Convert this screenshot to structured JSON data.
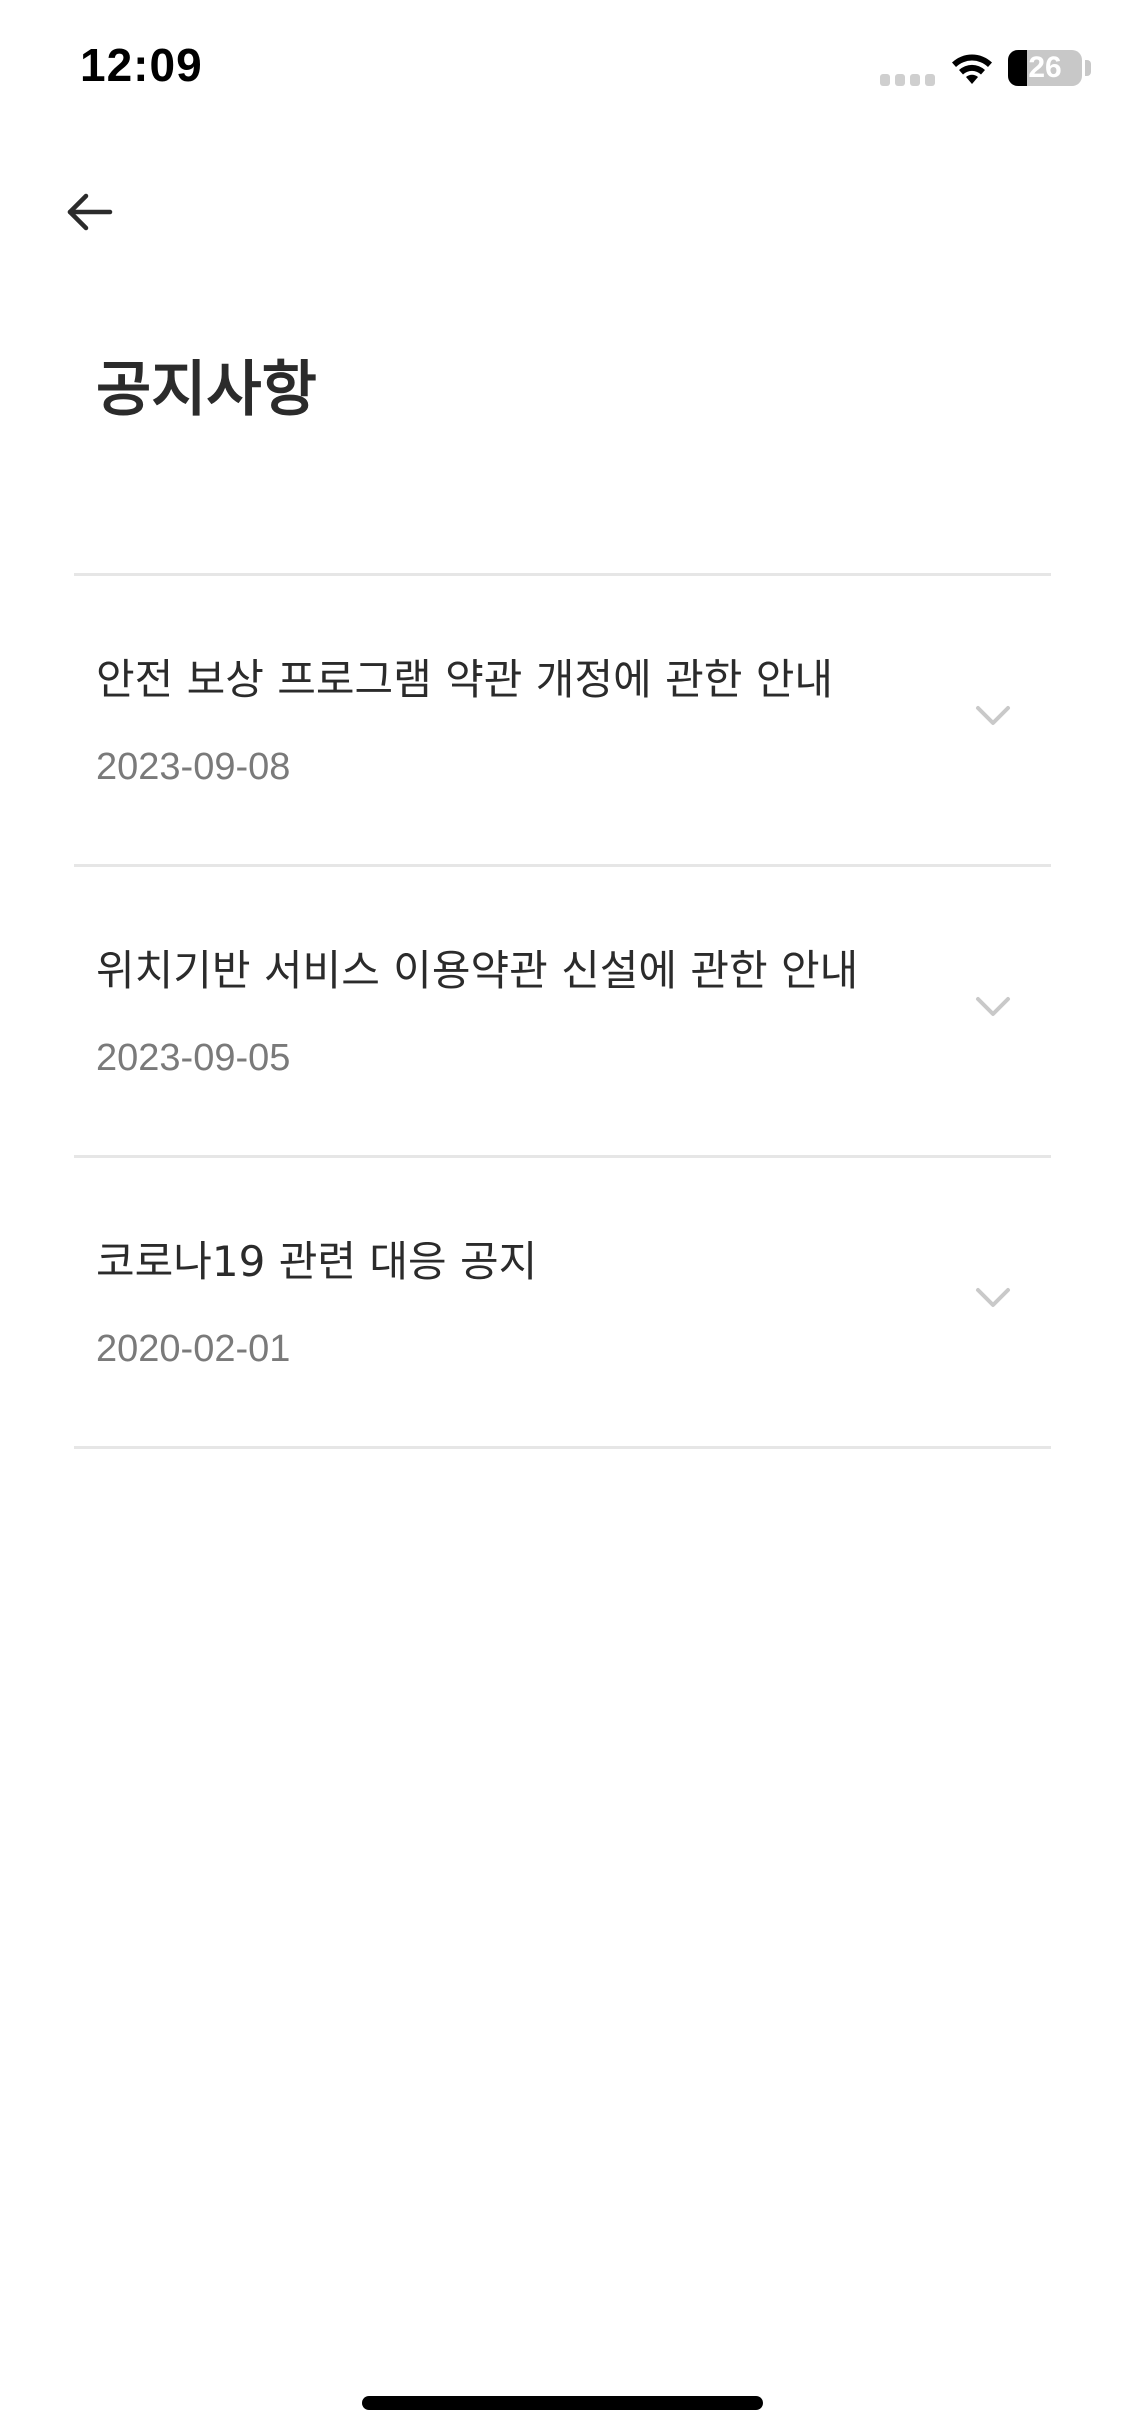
{
  "status_bar": {
    "time": "12:09",
    "battery_level": "26",
    "battery_fraction": 0.26,
    "signal_icon": "signal-bars-icon",
    "wifi_icon": "wifi-icon"
  },
  "header": {
    "back_icon": "arrow-left-icon",
    "title": "공지사항"
  },
  "notices": [
    {
      "title": "안전 보상 프로그램 약관 개정에 관한 안내",
      "date": "2023-09-08"
    },
    {
      "title": "위치기반 서비스 이용약관 신설에 관한 안내",
      "date": "2023-09-05"
    },
    {
      "title": "코로나19 관련 대응 공지",
      "date": "2020-02-01"
    }
  ],
  "colors": {
    "text_primary": "#2b2b2b",
    "text_secondary": "#7a7a7a",
    "divider": "#e6e6e6",
    "chevron": "#c9c9c9"
  }
}
